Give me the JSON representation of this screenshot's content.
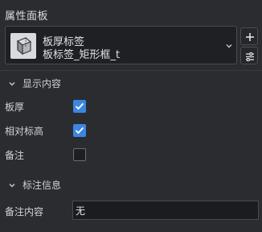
{
  "panel": {
    "title": "属性面板"
  },
  "selector": {
    "line1": "板厚标签",
    "line2": "板标签_矩形框_t",
    "icon": "wireframe-cube-icon"
  },
  "actions": {
    "add_icon": "plus-icon",
    "list_icon": "sliders-icon"
  },
  "sections": [
    {
      "label": "显示内容",
      "expanded": true,
      "rows": [
        {
          "label": "板厚",
          "checked": true
        },
        {
          "label": "相对标高",
          "checked": true
        },
        {
          "label": "备注",
          "checked": false
        }
      ]
    },
    {
      "label": "标注信息",
      "expanded": true,
      "rows": [
        {
          "label": "备注内容",
          "value": "无"
        }
      ]
    }
  ],
  "colors": {
    "accent": "#3d86e0",
    "background": "#2b2c30"
  }
}
